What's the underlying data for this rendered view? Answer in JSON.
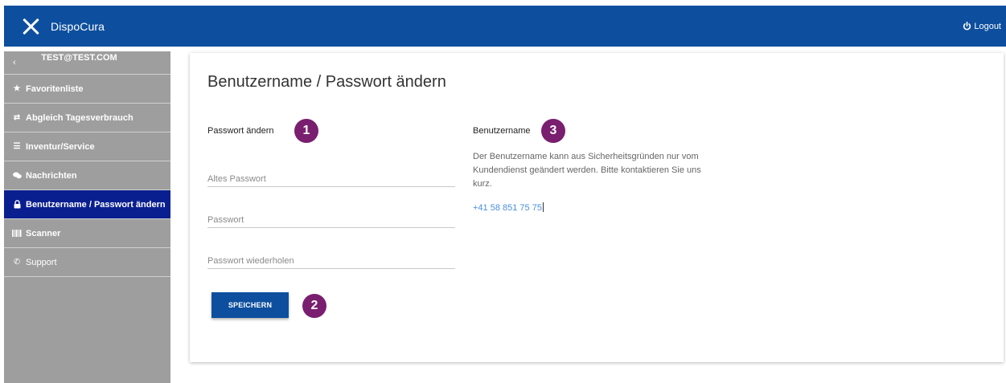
{
  "header": {
    "app_title": "DispoCura",
    "logout_label": "Logout",
    "bar_color": "#0d4f9e"
  },
  "sidebar": {
    "user_email": "TEST@TEST.COM",
    "items": [
      {
        "label": "Favoritenliste",
        "icon": "star-icon",
        "active": false
      },
      {
        "label": "Abgleich Tagesverbrauch",
        "icon": "swap-arrows-icon",
        "active": false
      },
      {
        "label": "Inventur/Service",
        "icon": "list-icon",
        "active": false
      },
      {
        "label": "Nachrichten",
        "icon": "chat-icon",
        "active": false
      },
      {
        "label": "Benutzername / Passwort ändern",
        "icon": "lock-icon",
        "active": true
      },
      {
        "label": "Scanner",
        "icon": "barcode-icon",
        "active": false
      },
      {
        "label": "Support",
        "icon": "phone-icon",
        "active": false
      }
    ],
    "active_color": "#0a1f8f",
    "background_color": "#9e9e9e"
  },
  "main": {
    "page_title": "Benutzername / Passwort ändern",
    "password_section": {
      "title": "Passwort ändern",
      "badge": "1",
      "fields": [
        {
          "placeholder": "Altes Passwort",
          "value": ""
        },
        {
          "placeholder": "Passwort",
          "value": ""
        },
        {
          "placeholder": "Passwort wiederholen",
          "value": ""
        }
      ],
      "save_label": "SPEICHERN",
      "save_badge": "2"
    },
    "username_section": {
      "title": "Benutzername",
      "badge": "3",
      "description": "Der Benutzername kann aus Sicherheitsgründen nur vom Kundendienst geändert werden. Bitte kontaktieren Sie uns kurz.",
      "phone": "+41 58 851 75 75"
    },
    "badge_color": "#7a1e6f"
  }
}
